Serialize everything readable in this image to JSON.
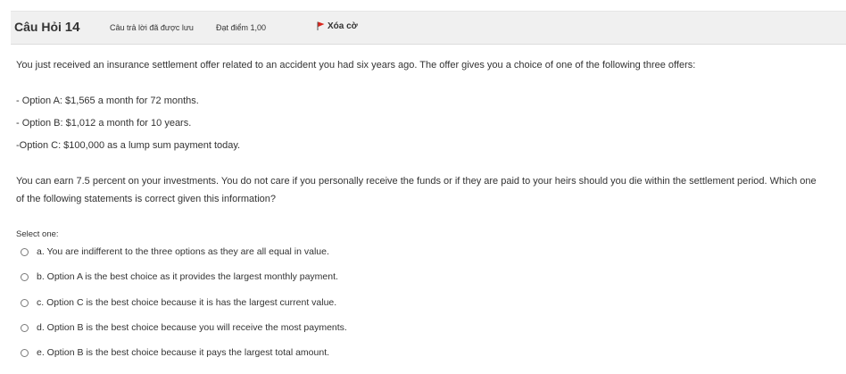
{
  "header": {
    "question_word": "Câu Hỏi",
    "question_number": "14",
    "state": "Câu trả lời đã được lưu",
    "grade": "Đạt điểm 1,00",
    "flag_label": "Xóa cờ",
    "flag_color": "#d9251c"
  },
  "question": {
    "intro": "You just received an insurance settlement offer related to an accident you had six years ago. The offer gives you a choice of one of the following three offers:",
    "option_a_line": "- Option A: $1,565 a month for 72 months.",
    "option_b_line": "- Option B: $1,012 a month for 10 years.",
    "option_c_line": "-Option C: $100,000 as a lump sum payment today.",
    "body": "You can earn 7.5 percent on your investments. You do not care if you personally receive the funds or if they are paid to your heirs should you die within the settlement period. Which one of the following statements is correct given this information?"
  },
  "answers": {
    "select_label": "Select one:",
    "options": [
      "a. You are indifferent to the three options as they are all equal in value.",
      "b. Option A is the best choice as it provides the largest monthly payment.",
      "c. Option C is the best choice because it is has the largest current value.",
      "d. Option B is the best choice because you will receive the most payments.",
      "e. Option B is the best choice because it pays the largest total amount."
    ]
  }
}
